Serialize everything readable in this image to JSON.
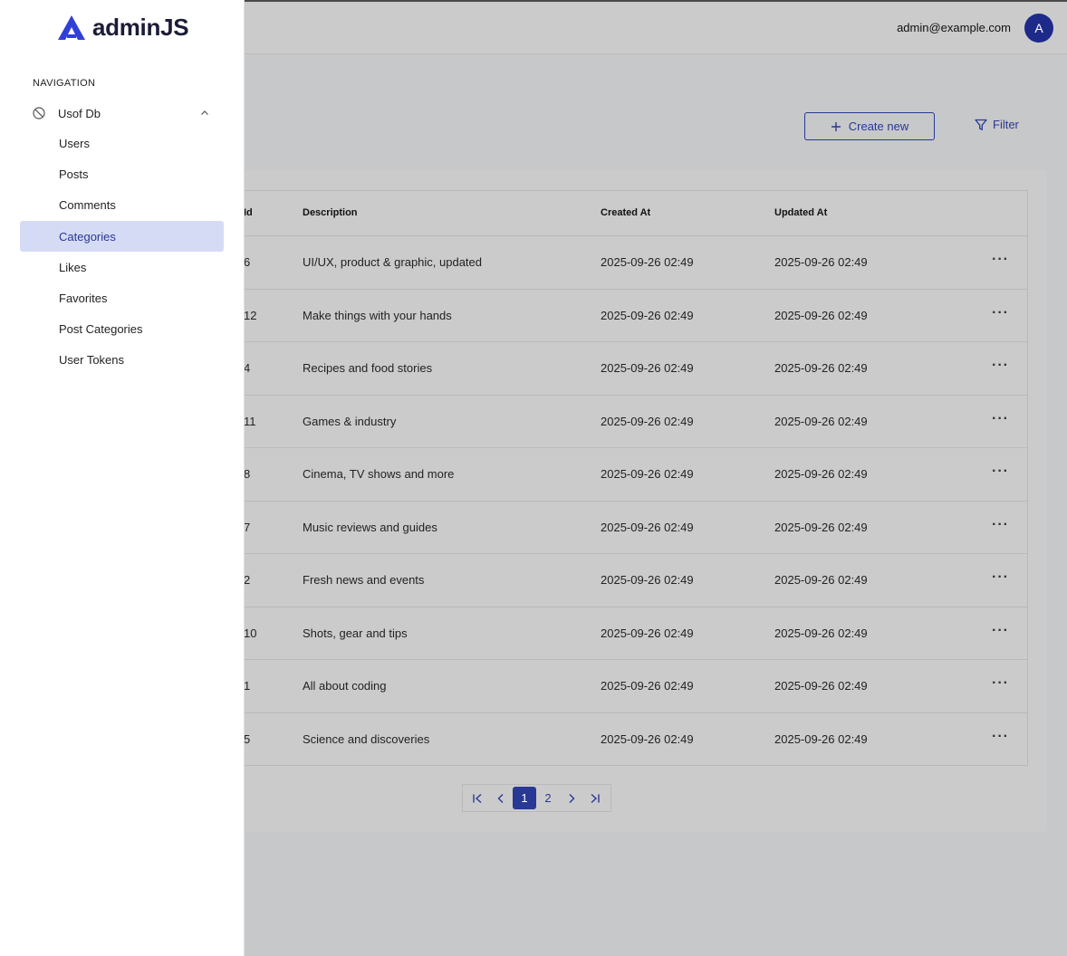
{
  "brand": {
    "name": "adminJS"
  },
  "header": {
    "user_email": "admin@example.com",
    "avatar_letter": "A"
  },
  "toolbar": {
    "create_label": "Create new",
    "filter_label": "Filter"
  },
  "sidebar": {
    "nav_title": "NAVIGATION",
    "group_label": "Usof Db",
    "items": [
      {
        "label": "Users",
        "active": false
      },
      {
        "label": "Posts",
        "active": false
      },
      {
        "label": "Comments",
        "active": false
      },
      {
        "label": "Categories",
        "active": true
      },
      {
        "label": "Likes",
        "active": false
      },
      {
        "label": "Favorites",
        "active": false
      },
      {
        "label": "Post Categories",
        "active": false
      },
      {
        "label": "User Tokens",
        "active": false
      }
    ]
  },
  "table": {
    "headers": {
      "id": "Id",
      "description": "Description",
      "created": "Created At",
      "updated": "Updated At"
    },
    "rows": [
      {
        "id": "6",
        "description": "UI/UX, product & graphic, updated",
        "created": "2025-09-26 02:49",
        "updated": "2025-09-26 02:49"
      },
      {
        "id": "12",
        "description": "Make things with your hands",
        "created": "2025-09-26 02:49",
        "updated": "2025-09-26 02:49"
      },
      {
        "id": "4",
        "description": "Recipes and food stories",
        "created": "2025-09-26 02:49",
        "updated": "2025-09-26 02:49"
      },
      {
        "id": "11",
        "description": "Games & industry",
        "created": "2025-09-26 02:49",
        "updated": "2025-09-26 02:49"
      },
      {
        "id": "8",
        "description": "Cinema, TV shows and more",
        "created": "2025-09-26 02:49",
        "updated": "2025-09-26 02:49"
      },
      {
        "id": "7",
        "description": "Music reviews and guides",
        "created": "2025-09-26 02:49",
        "updated": "2025-09-26 02:49"
      },
      {
        "id": "2",
        "description": "Fresh news and events",
        "created": "2025-09-26 02:49",
        "updated": "2025-09-26 02:49"
      },
      {
        "id": "10",
        "description": "Shots, gear and tips",
        "created": "2025-09-26 02:49",
        "updated": "2025-09-26 02:49"
      },
      {
        "id": "1",
        "description": "All about coding",
        "created": "2025-09-26 02:49",
        "updated": "2025-09-26 02:49"
      },
      {
        "id": "5",
        "description": "Science and discoveries",
        "created": "2025-09-26 02:49",
        "updated": "2025-09-26 02:49"
      }
    ],
    "more_glyph": "···"
  },
  "pagination": {
    "pages": [
      "1",
      "2"
    ],
    "current": "1"
  },
  "colors": {
    "primary": "#283895",
    "active_bg": "#d6dbf5",
    "overlay": "#c7c8c9"
  }
}
